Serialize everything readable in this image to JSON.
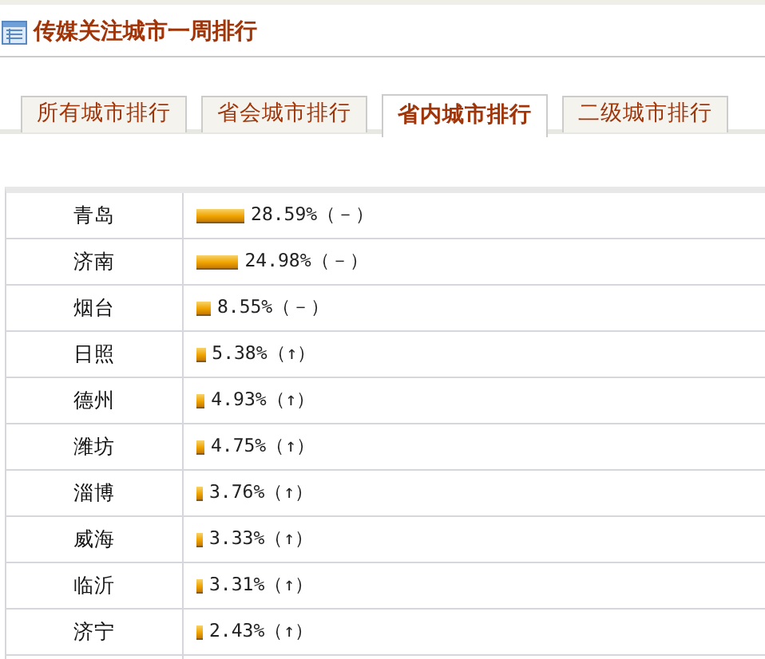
{
  "header": {
    "title": "传媒关注城市一周排行"
  },
  "tabs": [
    {
      "label": "所有城市排行",
      "selected": false
    },
    {
      "label": "省会城市排行",
      "selected": false
    },
    {
      "label": "省内城市排行",
      "selected": true
    },
    {
      "label": "二级城市排行",
      "selected": false
    }
  ],
  "rows": [
    {
      "city": "青岛",
      "reading": "28.59%（－）"
    },
    {
      "city": "济南",
      "reading": "24.98%（－）"
    },
    {
      "city": "烟台",
      "reading": "8.55%（－）"
    },
    {
      "city": "日照",
      "reading": "5.38%（↑）"
    },
    {
      "city": "德州",
      "reading": "4.93%（↑）"
    },
    {
      "city": "潍坊",
      "reading": "4.75%（↑）"
    },
    {
      "city": "淄博",
      "reading": "3.76%（↑）"
    },
    {
      "city": "威海",
      "reading": "3.33%（↑）"
    },
    {
      "city": "临沂",
      "reading": "3.31%（↑）"
    },
    {
      "city": "济宁",
      "reading": "2.43%（↑）"
    }
  ]
}
